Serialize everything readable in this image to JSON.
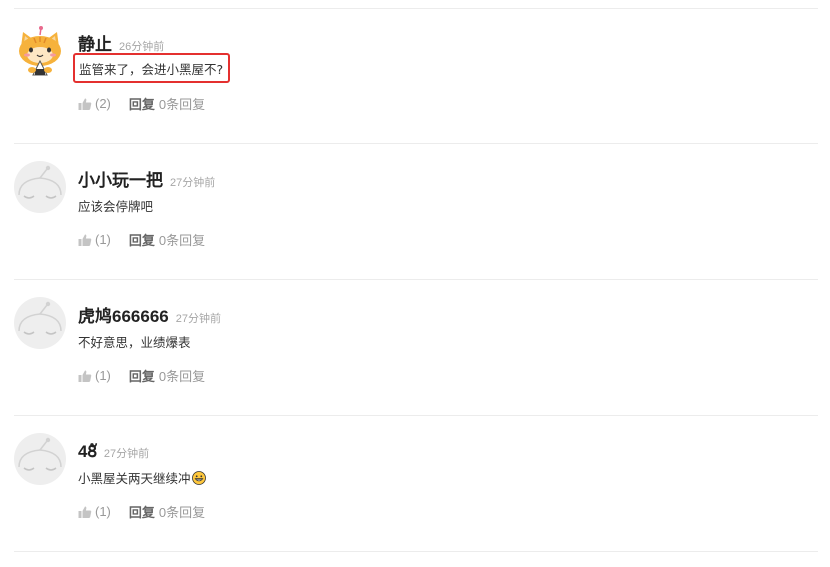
{
  "comments": [
    {
      "username": "静止",
      "time": "26分钟前",
      "text": "监管来了，会进小黑屋不?",
      "highlighted": true,
      "likes": "(2)",
      "reply_label": "回复",
      "reply_count": "0条回复",
      "avatar": "cat-avatar-icon"
    },
    {
      "username": "小小玩一把",
      "time": "27分钟前",
      "text": "应该会停牌吧",
      "highlighted": false,
      "likes": "(1)",
      "reply_label": "回复",
      "reply_count": "0条回复",
      "avatar": "default-avatar-icon"
    },
    {
      "username": "虎鸠666666",
      "time": "27分钟前",
      "text": "不好意思，业绩爆表",
      "highlighted": false,
      "likes": "(1)",
      "reply_label": "回复",
      "reply_count": "0条回复",
      "avatar": "default-avatar-icon"
    },
    {
      "username": "48ั",
      "time": "27分钟前",
      "text": "小黑屋关两天继续冲",
      "highlighted": false,
      "has_emoji": "grinning-emoji-icon",
      "likes": "(1)",
      "reply_label": "回复",
      "reply_count": "0条回复",
      "avatar": "default-avatar-icon"
    }
  ],
  "colors": {
    "highlight_border": "#e4302f",
    "timestamp": "#a6a6a6",
    "divider": "#ececec",
    "like_icon": "#c4c4c4"
  }
}
